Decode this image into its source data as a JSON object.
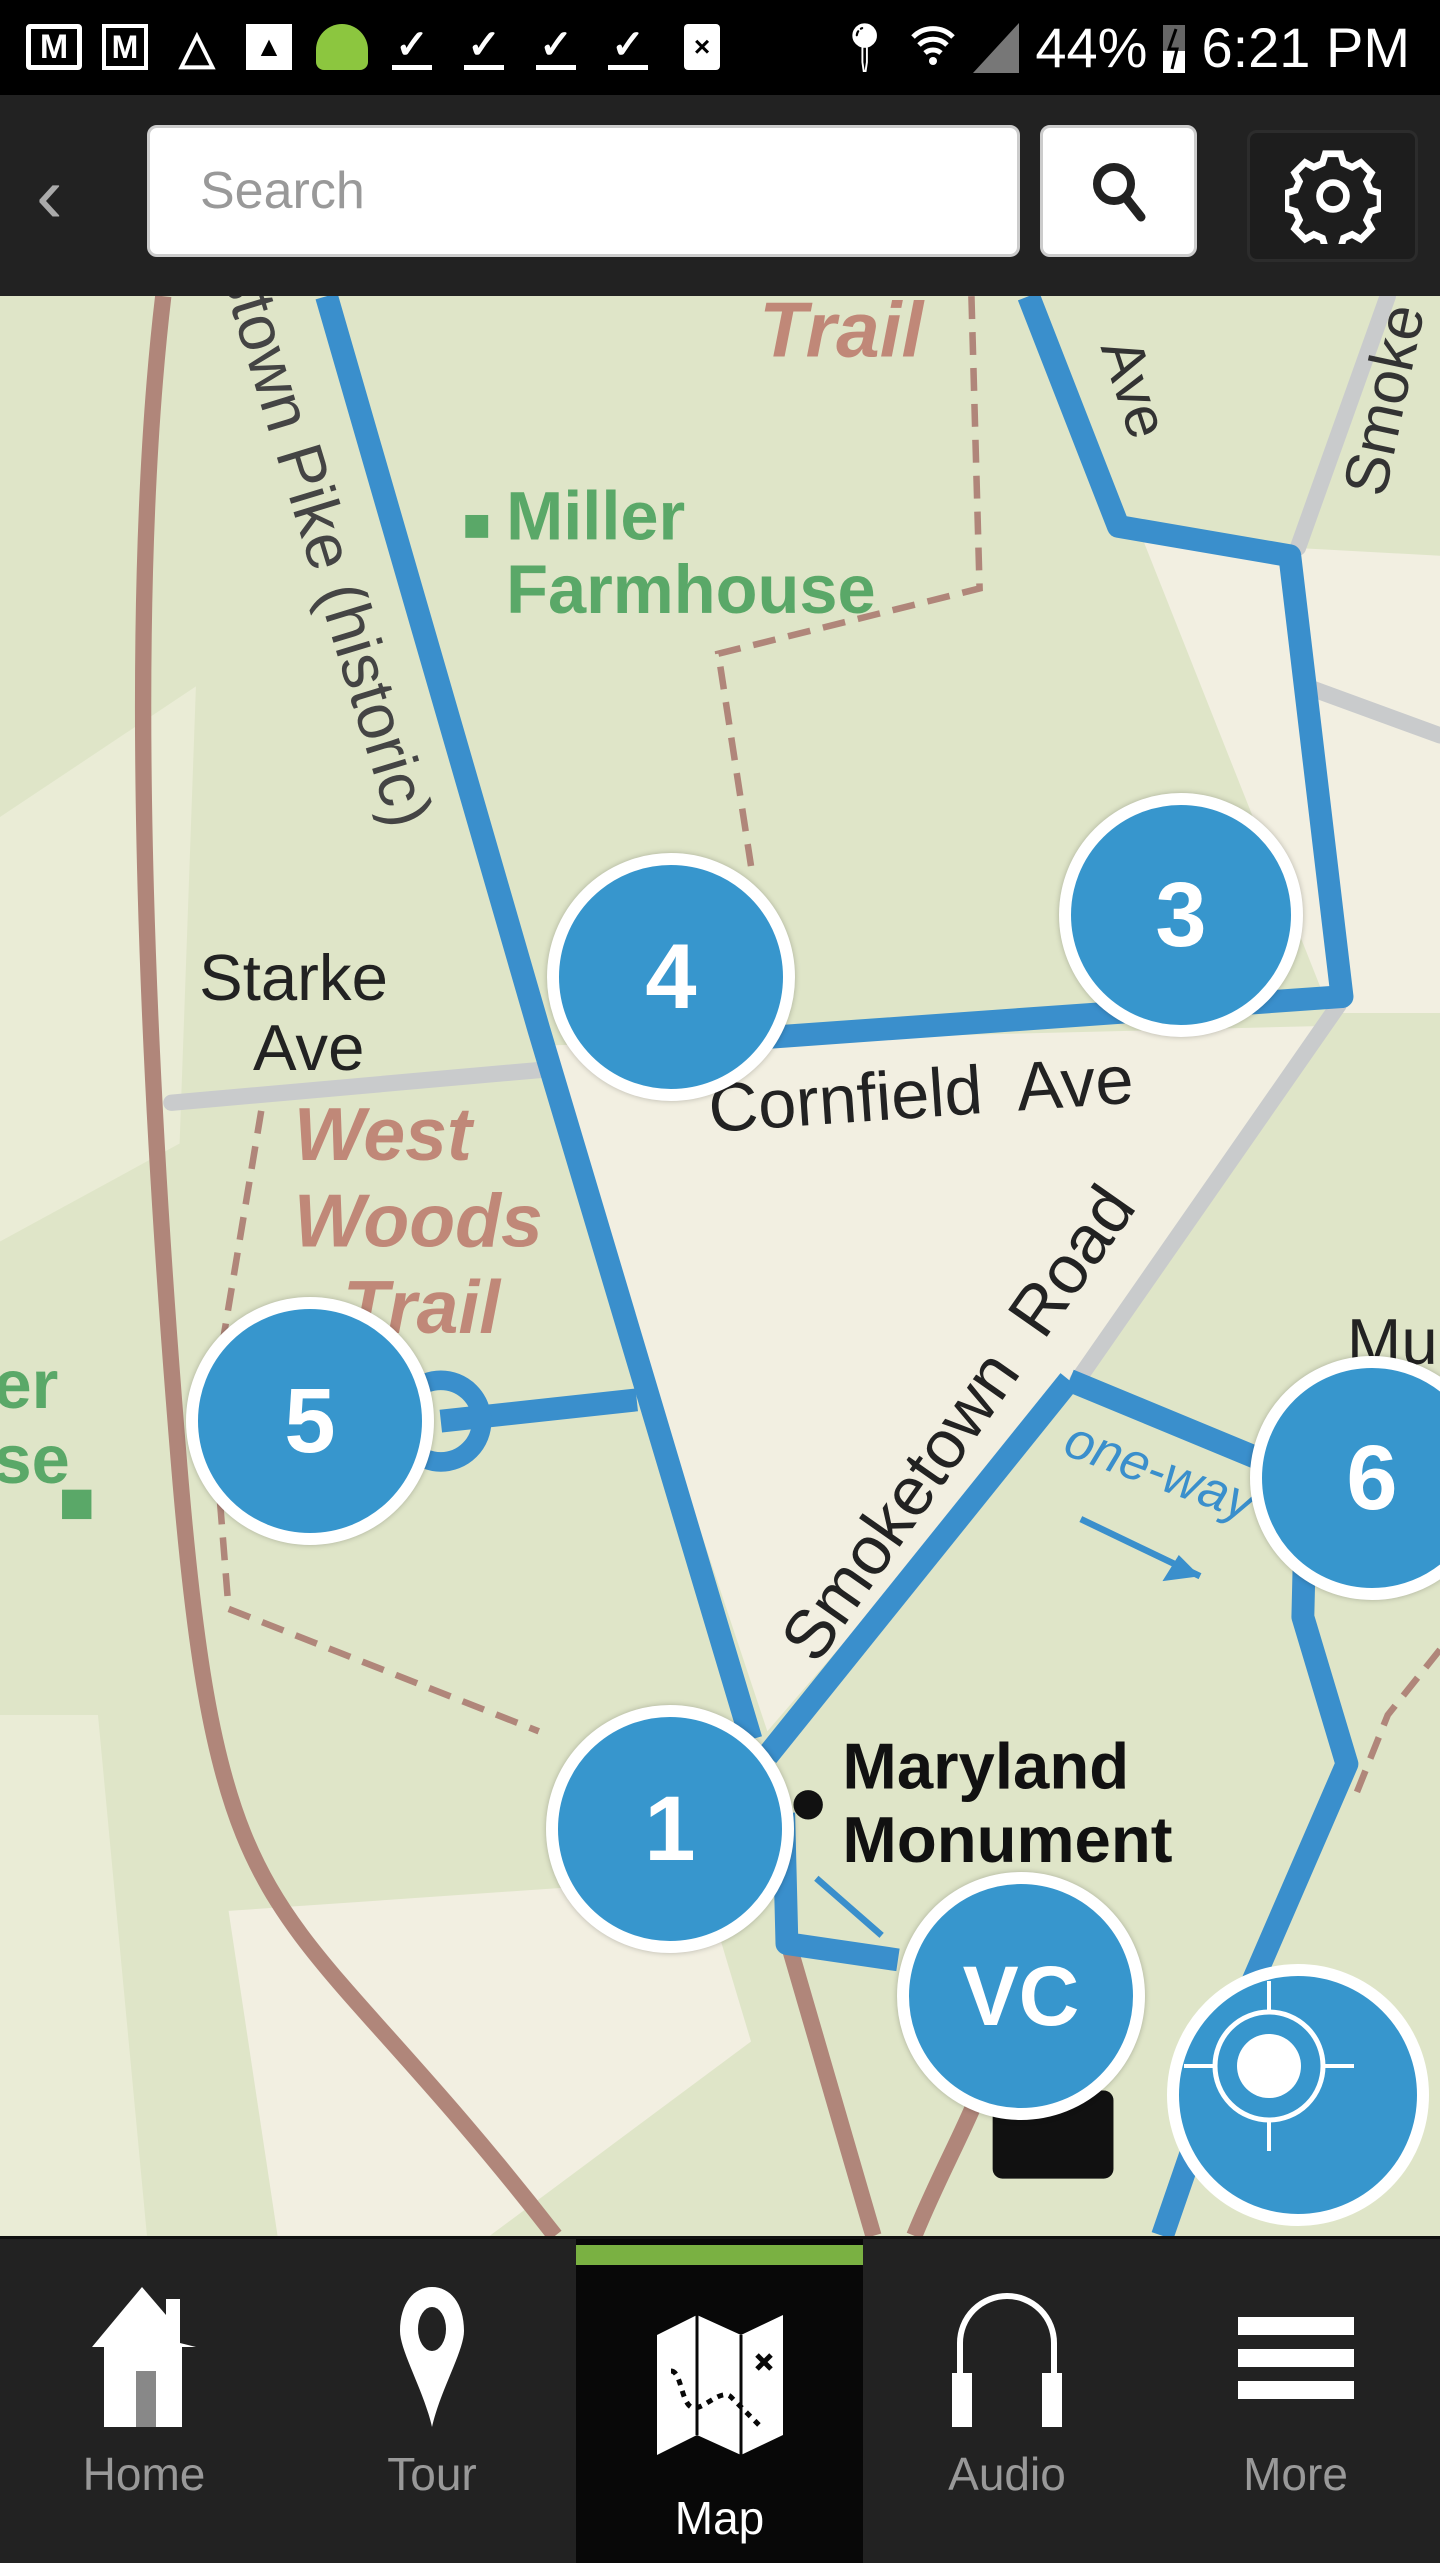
{
  "status_bar": {
    "left_icons": [
      "gmail-icon",
      "gmail-icon",
      "drive-icon",
      "photo-icon",
      "android-icon",
      "download-done-icon",
      "download-done-icon",
      "download-done-icon",
      "download-done-icon",
      "sim-error-icon"
    ],
    "right_icons": [
      "location-icon",
      "wifi-icon",
      "signal-icon",
      "battery-charging-icon"
    ],
    "battery": "44%",
    "time": "6:21 PM"
  },
  "top_bar": {
    "back_icon": "chevron-left-icon",
    "search_placeholder": "Search",
    "search_value": "",
    "search_button_icon": "search-icon",
    "settings_icon": "gear-icon"
  },
  "map": {
    "labels": {
      "trail_top": "Trail",
      "ave_top": "Ave",
      "smoke_top": "Smoke",
      "miller_1": "Miller",
      "miller_2": "Farmhouse",
      "hagerstown": "Hagerstown Pike (historic)",
      "starke_1": "Starke",
      "starke_2": "Ave",
      "cornfield": "Cornfield  Ave",
      "west_1": "West",
      "west_2": "Woods",
      "west_3": "Trail",
      "smoketown": "Smoketown  Road",
      "oneway": "one-way",
      "maryland_1": "Maryland",
      "maryland_2": "Monument",
      "left_frag_1": "er",
      "left_frag_2": "se",
      "right_frag": "Mu"
    },
    "markers": [
      "1",
      "3",
      "4",
      "5",
      "6",
      "VC"
    ],
    "locate_icon": "crosshair-locate-icon",
    "colors": {
      "route": "#3a8fcc",
      "road": "#c9cbcc",
      "trail": "#b0867a",
      "land": "#dfe5c8",
      "field": "#f2efe1",
      "label_green": "#5aa868"
    }
  },
  "bottom_nav": {
    "active": "Map",
    "accent": "#7ab142",
    "tabs": [
      {
        "label": "Home",
        "icon": "home-icon"
      },
      {
        "label": "Tour",
        "icon": "map-pin-icon"
      },
      {
        "label": "Map",
        "icon": "treasure-map-icon"
      },
      {
        "label": "Audio",
        "icon": "headphones-icon"
      },
      {
        "label": "More",
        "icon": "hamburger-menu-icon"
      }
    ]
  }
}
